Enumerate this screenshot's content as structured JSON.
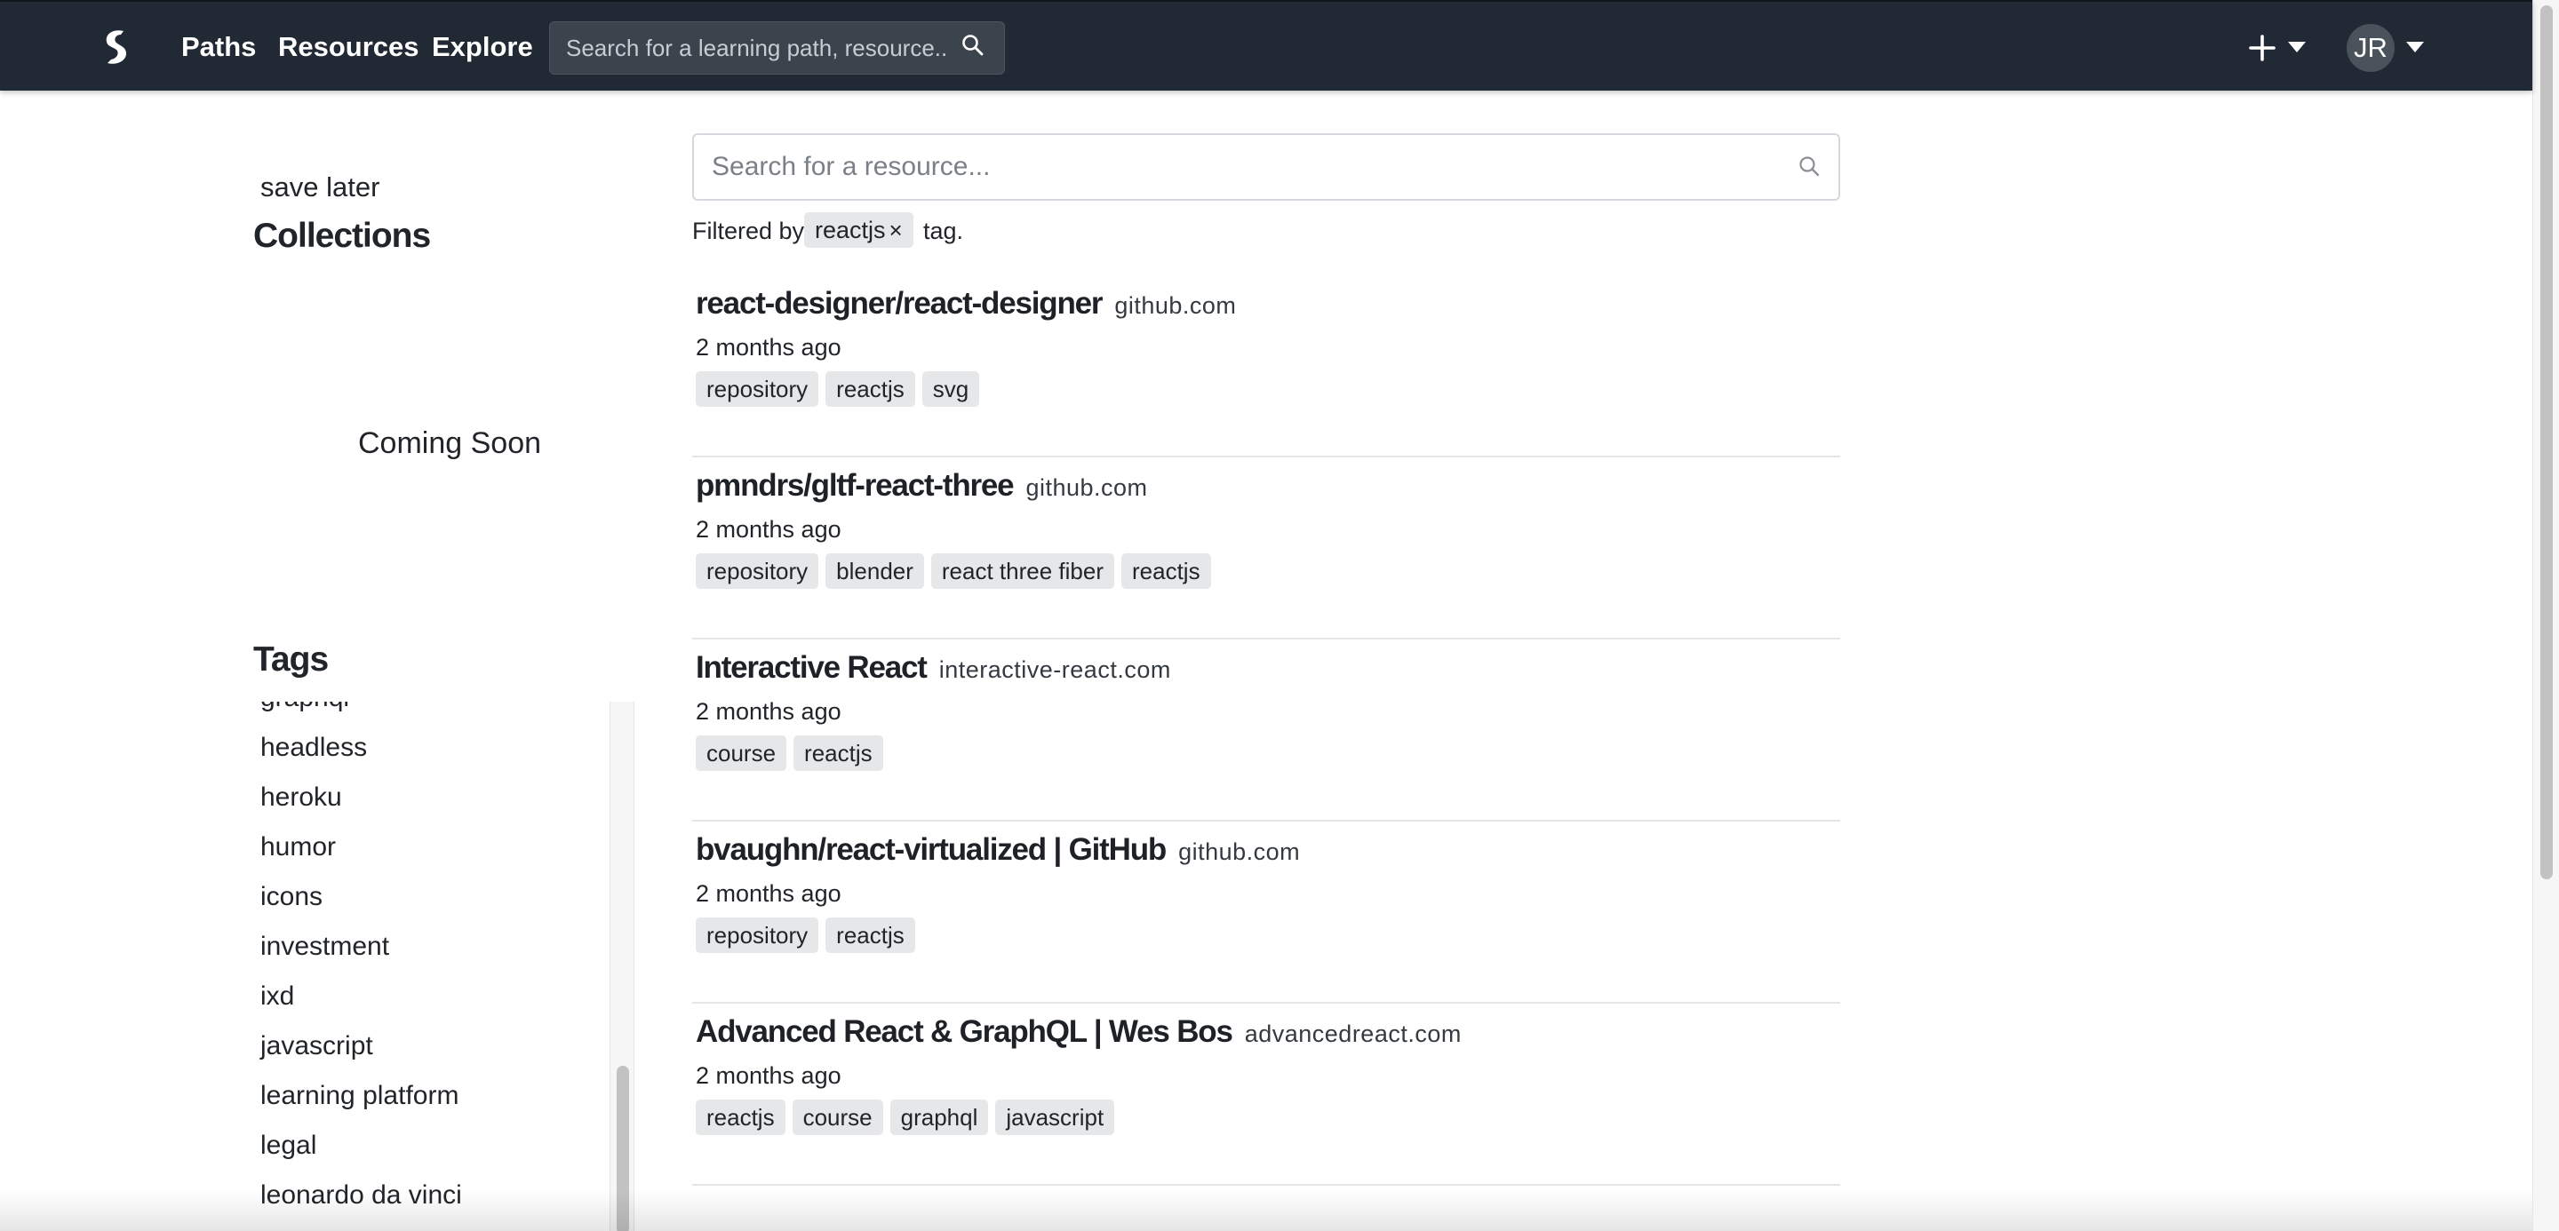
{
  "navbar": {
    "links": [
      "Paths",
      "Resources",
      "Explore"
    ],
    "search_placeholder": "Search for a learning path, resource...",
    "avatar_initials": "JR"
  },
  "sidebar": {
    "save_later": "save later",
    "collections_heading": "Collections",
    "coming_soon": "Coming Soon",
    "tags_heading": "Tags",
    "tags": [
      "graphql",
      "headless",
      "heroku",
      "humor",
      "icons",
      "investment",
      "ixd",
      "javascript",
      "learning platform",
      "legal",
      "leonardo da vinci"
    ]
  },
  "main": {
    "search_placeholder": "Search for a resource...",
    "filter": {
      "prefix": "Filtered by",
      "tag": "reactjs",
      "remove_symbol": "×",
      "suffix": "tag."
    },
    "resources": [
      {
        "title": "react-designer/react-designer",
        "domain": "github.com",
        "time": "2 months ago",
        "tags": [
          "repository",
          "reactjs",
          "svg"
        ]
      },
      {
        "title": "pmndrs/gltf-react-three",
        "domain": "github.com",
        "time": "2 months ago",
        "tags": [
          "repository",
          "blender",
          "react three fiber",
          "reactjs"
        ]
      },
      {
        "title": "Interactive React",
        "domain": "interactive-react.com",
        "time": "2 months ago",
        "tags": [
          "course",
          "reactjs"
        ]
      },
      {
        "title": "bvaughn/react-virtualized | GitHub",
        "domain": "github.com",
        "time": "2 months ago",
        "tags": [
          "repository",
          "reactjs"
        ]
      },
      {
        "title": "Advanced React & GraphQL | Wes Bos",
        "domain": "advancedreact.com",
        "time": "2 months ago",
        "tags": [
          "reactjs",
          "course",
          "graphql",
          "javascript"
        ]
      }
    ]
  },
  "colors": {
    "navbar_bg": "#212934",
    "chip_bg": "#e6e7e9",
    "text": "#212529"
  }
}
